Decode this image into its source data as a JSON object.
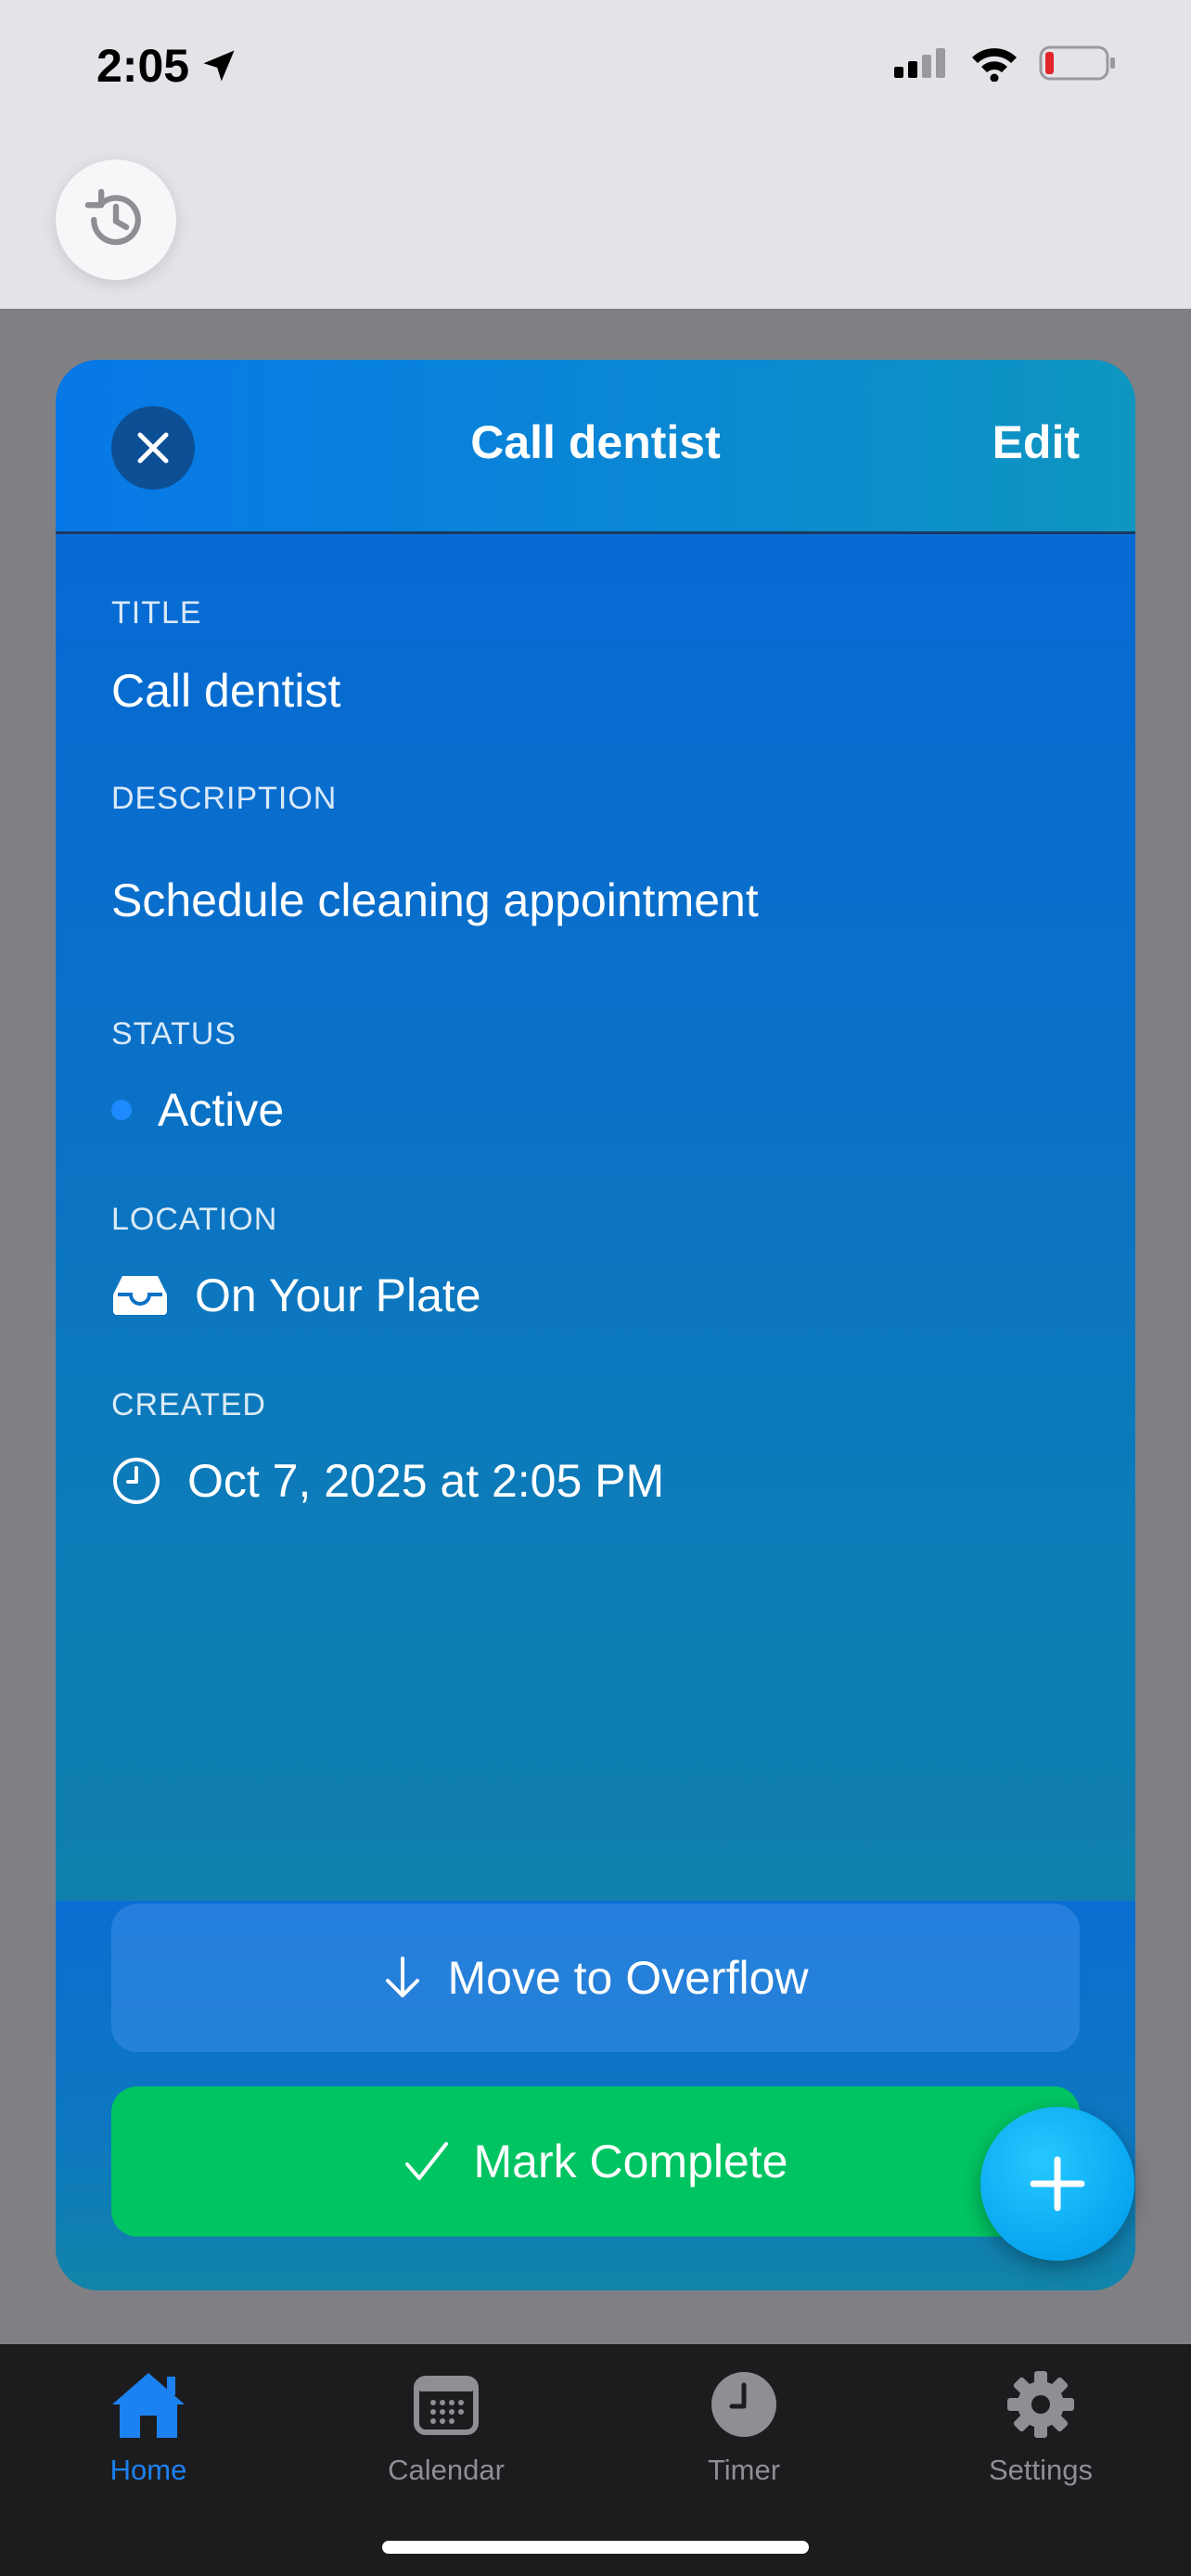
{
  "status_bar": {
    "time": "2:05"
  },
  "sheet": {
    "header_title": "Call dentist",
    "edit_label": "Edit",
    "fields": {
      "title_label": "TITLE",
      "title_value": "Call dentist",
      "description_label": "DESCRIPTION",
      "description_value": "Schedule cleaning appointment",
      "status_label": "STATUS",
      "status_value": "Active",
      "location_label": "LOCATION",
      "location_value": "On Your Plate",
      "created_label": "CREATED",
      "created_value": "Oct 7, 2025 at 2:05 PM"
    },
    "overflow_button": "Move to Overflow",
    "complete_button": "Mark Complete"
  },
  "tabs": [
    {
      "label": "Home",
      "icon": "home-icon",
      "active": true
    },
    {
      "label": "Calendar",
      "icon": "calendar-icon",
      "active": false
    },
    {
      "label": "Timer",
      "icon": "clock-icon",
      "active": false
    },
    {
      "label": "Settings",
      "icon": "gear-icon",
      "active": false
    }
  ],
  "colors": {
    "accent": "#1c82f2",
    "complete_green": "#00c462",
    "status_dot": "#1d8bff",
    "battery_low": "#e0262b"
  }
}
